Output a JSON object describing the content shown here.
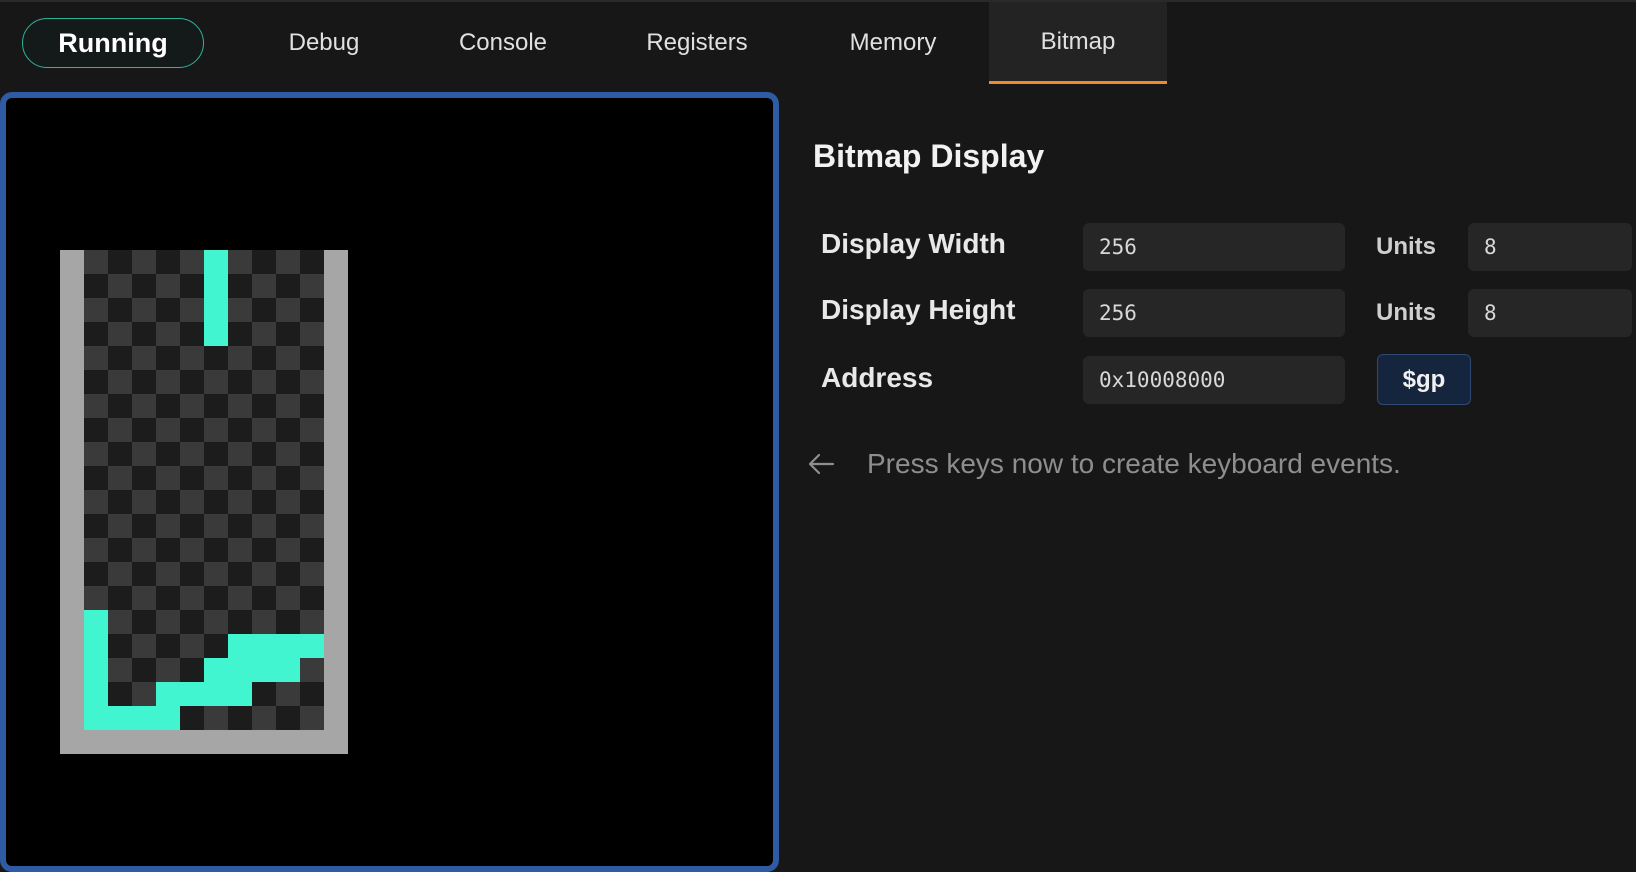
{
  "status": {
    "label": "Running",
    "accent": "#2fb39a"
  },
  "tabs": [
    {
      "label": "Debug"
    },
    {
      "label": "Console"
    },
    {
      "label": "Registers"
    },
    {
      "label": "Memory"
    },
    {
      "label": "Bitmap",
      "active": true
    }
  ],
  "colors": {
    "active_tab_underline": "#f08a2a",
    "frame_border": "#2e5ba3",
    "piece": "#40f5d0",
    "wall": "#a6a6a6",
    "checker_dark": "#1c1c1c",
    "checker_light": "#3a3a3a"
  },
  "bitmap_panel": {
    "title": "Bitmap Display",
    "width_label": "Display Width",
    "width_value": "256",
    "width_units_label": "Units",
    "width_units_value": "8",
    "height_label": "Display Height",
    "height_value": "256",
    "height_units_label": "Units",
    "height_units_value": "8",
    "address_label": "Address",
    "address_value": "0x10008000",
    "gp_button_label": "$gp",
    "hint_icon": "arrow-left-icon",
    "hint_text": "Press keys now to create keyboard events."
  },
  "bitmap_grid": {
    "well_cols": 10,
    "well_rows": 20,
    "filled_cells": [
      [
        5,
        0
      ],
      [
        5,
        1
      ],
      [
        5,
        2
      ],
      [
        5,
        3
      ],
      [
        0,
        15
      ],
      [
        0,
        16
      ],
      [
        0,
        17
      ],
      [
        0,
        18
      ],
      [
        0,
        19
      ],
      [
        1,
        19
      ],
      [
        2,
        19
      ],
      [
        3,
        19
      ],
      [
        3,
        18
      ],
      [
        4,
        18
      ],
      [
        5,
        18
      ],
      [
        6,
        18
      ],
      [
        5,
        17
      ],
      [
        6,
        17
      ],
      [
        7,
        17
      ],
      [
        8,
        17
      ],
      [
        6,
        16
      ],
      [
        7,
        16
      ],
      [
        8,
        16
      ],
      [
        9,
        16
      ]
    ]
  }
}
